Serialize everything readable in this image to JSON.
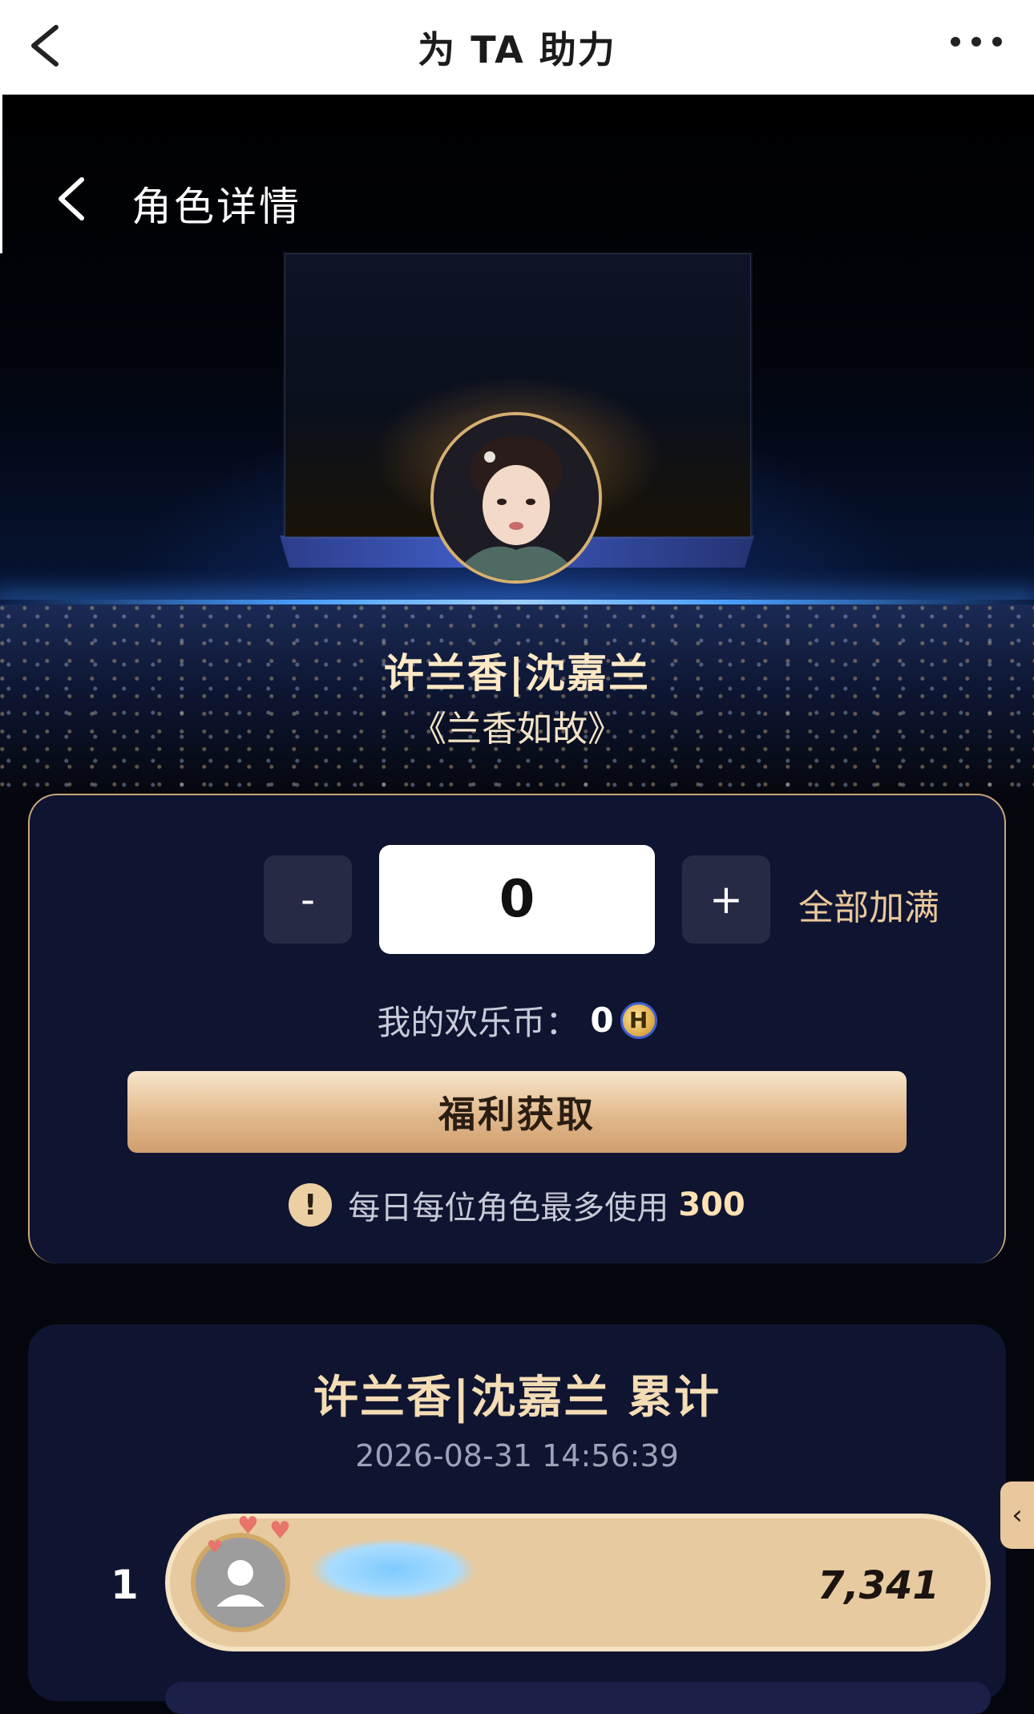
{
  "navbar": {
    "title": "为 TA 助力",
    "back_icon": "chevron-left-icon",
    "more_icon": "more-dots-icon"
  },
  "detail_header": {
    "title": "角色详情",
    "back_icon": "chevron-left-icon"
  },
  "character": {
    "name": "许兰香|沈嘉兰",
    "drama": "《兰香如故》"
  },
  "boost": {
    "minus_label": "-",
    "plus_label": "+",
    "quantity": "0",
    "fill_all_label": "全部加满",
    "coins_label": "我的欢乐币：",
    "coins_value": "0",
    "coin_icon_glyph": "H",
    "welfare_button": "福利获取",
    "limit_text": "每日每位角色最多使用",
    "limit_value": "300",
    "warn_glyph": "!"
  },
  "ranking": {
    "title": "许兰香|沈嘉兰 累计",
    "timestamp": "2026-08-31 14:56:39",
    "rows": [
      {
        "rank": "1",
        "score": "7,341"
      }
    ],
    "side_handle_glyph": "‹"
  },
  "colors": {
    "accent_gold": "#e9c89b",
    "card_bg": "#0f1431",
    "rank_row_bg": "#e7caa0"
  }
}
